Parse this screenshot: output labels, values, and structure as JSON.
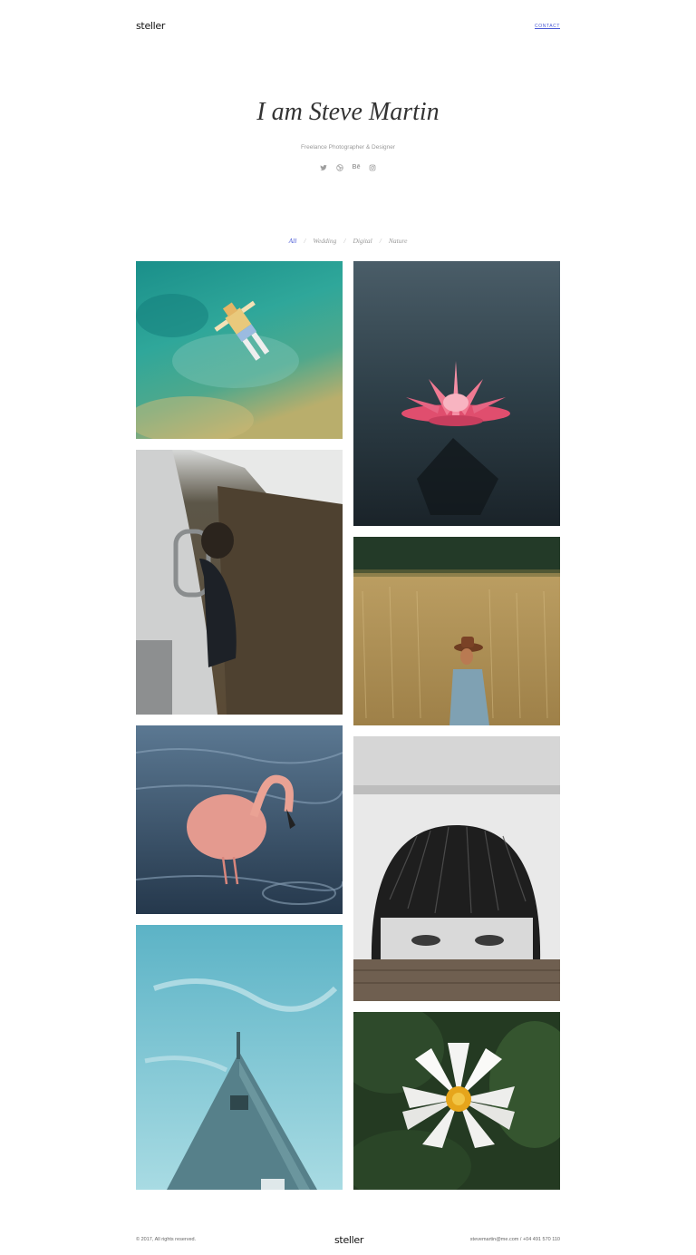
{
  "header": {
    "logo": "steller",
    "contact_label": "CONTACT"
  },
  "hero": {
    "title": "I am Steve Martin",
    "subtitle": "Freelance Photographer & Designer",
    "social_icons": [
      "twitter-icon",
      "dribbble-icon",
      "behance-icon",
      "instagram-icon"
    ],
    "behance_text": "Bē"
  },
  "filters": {
    "items": [
      "All",
      "Wedding",
      "Digital",
      "Nature"
    ],
    "active": "All",
    "separator": "/"
  },
  "gallery": {
    "photos": [
      "swimmer-aerial",
      "pink-water-lily",
      "helicopter-passenger",
      "man-in-wheat-field",
      "flamingo-in-water",
      "street-art-face",
      "house-roof-sky",
      "white-water-lily"
    ]
  },
  "footer": {
    "copyright": "© 2017, All rights reserved.",
    "logo": "steller",
    "contact": "stevemartin@me.com  /  +04 491 570 110"
  },
  "colors": {
    "accent": "#4a5ad6",
    "muted": "#9a9a9a"
  }
}
